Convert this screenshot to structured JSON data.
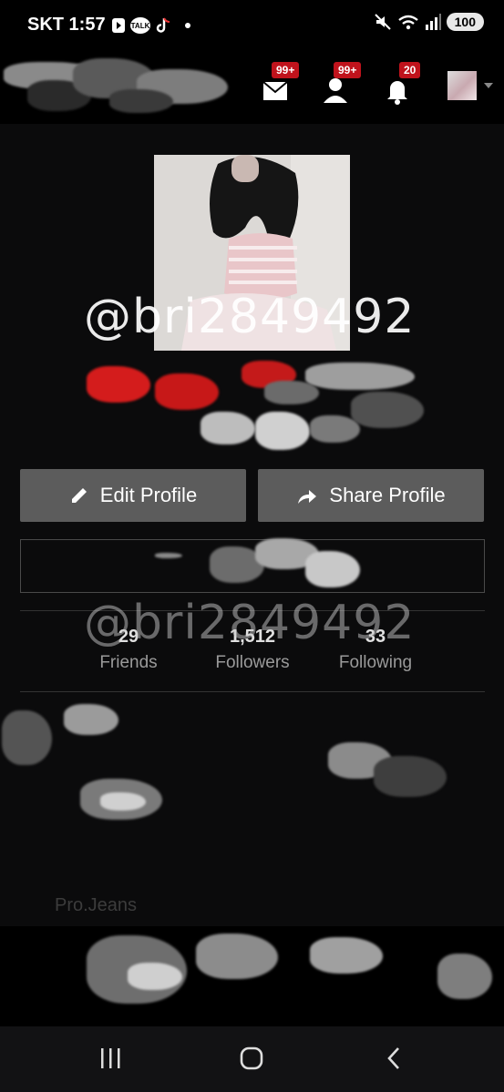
{
  "status_bar": {
    "carrier_time": "SKT 1:57",
    "app_icons": [
      "play-icon",
      "kakaotalk-icon",
      "tiktok-icon",
      "dot-icon"
    ],
    "kakao_label": "TALK",
    "right_icons": [
      "mute-icon",
      "wifi-icon",
      "signal-icon"
    ],
    "battery": "100"
  },
  "header": {
    "messages_badge": "99+",
    "friend_requests_badge": "99+",
    "notifications_badge": "20"
  },
  "profile": {
    "username_watermark": "@bri2849492"
  },
  "actions": {
    "edit_label": "Edit Profile",
    "share_label": "Share Profile"
  },
  "stats": [
    {
      "value": "29",
      "label": "Friends"
    },
    {
      "value": "1,512",
      "label": "Followers"
    },
    {
      "value": "33",
      "label": "Following"
    }
  ],
  "faded_text": "Pro.Jeans",
  "colors": {
    "badge": "#c0131c",
    "button": "#5c5c5c",
    "background": "#0b0b0c"
  }
}
